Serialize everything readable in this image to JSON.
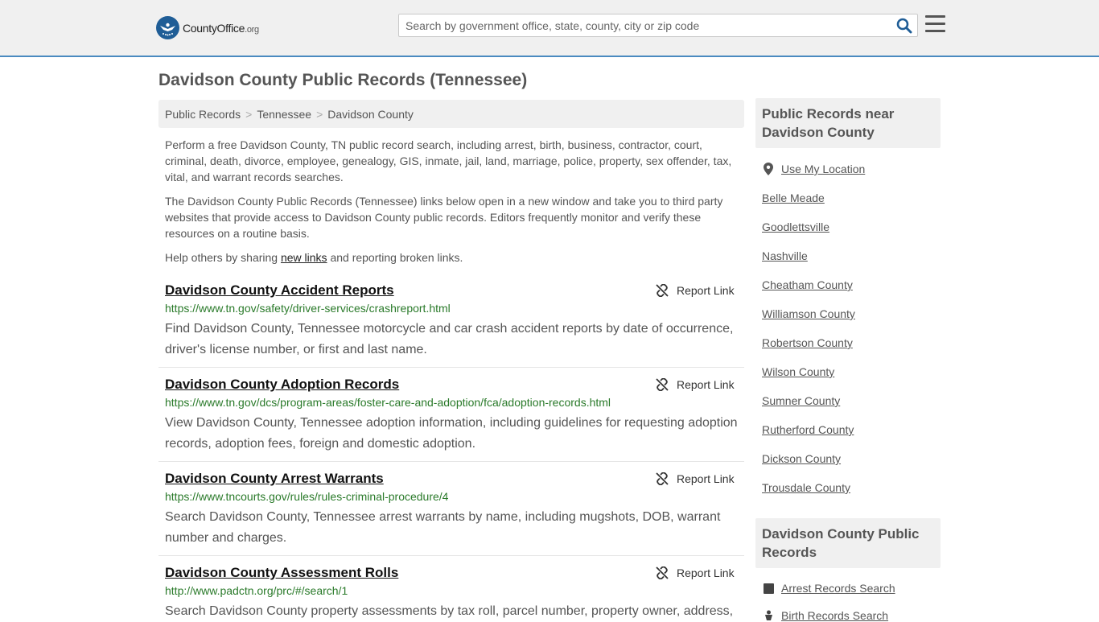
{
  "header": {
    "logo_main": "CountyOffice",
    "logo_suffix": ".org",
    "search_placeholder": "Search by government office, state, county, city or zip code"
  },
  "page_title": "Davidson County Public Records (Tennessee)",
  "breadcrumb": [
    "Public Records",
    "Tennessee",
    "Davidson County"
  ],
  "intro": {
    "p1": "Perform a free Davidson County, TN public record search, including arrest, birth, business, contractor, court, criminal, death, divorce, employee, genealogy, GIS, inmate, jail, land, marriage, police, property, sex offender, tax, vital, and warrant records searches.",
    "p2": "The Davidson County Public Records (Tennessee) links below open in a new window and take you to third party websites that provide access to Davidson County public records. Editors frequently monitor and verify these resources on a routine basis.",
    "p3_before": "Help others by sharing ",
    "p3_link": "new links",
    "p3_after": " and reporting broken links."
  },
  "report_label": "Report Link",
  "records": [
    {
      "title": "Davidson County Accident Reports",
      "url": "https://www.tn.gov/safety/driver-services/crashreport.html",
      "desc": "Find Davidson County, Tennessee motorcycle and car crash accident reports by date of occurrence, driver's license number, or first and last name."
    },
    {
      "title": "Davidson County Adoption Records",
      "url": "https://www.tn.gov/dcs/program-areas/foster-care-and-adoption/fca/adoption-records.html",
      "desc": "View Davidson County, Tennessee adoption information, including guidelines for requesting adoption records, adoption fees, foreign and domestic adoption."
    },
    {
      "title": "Davidson County Arrest Warrants",
      "url": "https://www.tncourts.gov/rules/rules-criminal-procedure/4",
      "desc": "Search Davidson County, Tennessee arrest warrants by name, including mugshots, DOB, warrant number and charges."
    },
    {
      "title": "Davidson County Assessment Rolls",
      "url": "http://www.padctn.org/prc/#/search/1",
      "desc": "Search Davidson County property assessments by tax roll, parcel number, property owner, address,"
    }
  ],
  "sidebar": {
    "nearby_heading": "Public Records near Davidson County",
    "use_location": "Use My Location",
    "nearby": [
      "Belle Meade",
      "Goodlettsville",
      "Nashville",
      "Cheatham County",
      "Williamson County",
      "Robertson County",
      "Wilson County",
      "Sumner County",
      "Rutherford County",
      "Dickson County",
      "Trousdale County"
    ],
    "records_heading": "Davidson County Public Records",
    "record_links": [
      "Arrest Records Search",
      "Birth Records Search"
    ]
  }
}
